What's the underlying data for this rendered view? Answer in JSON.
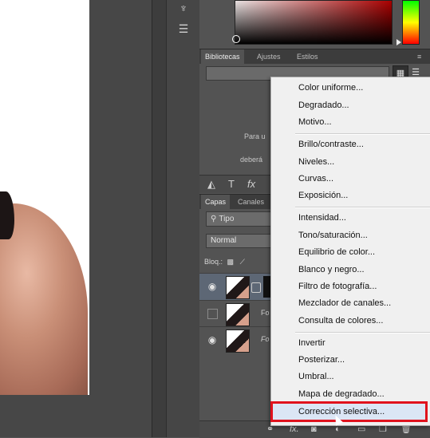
{
  "panels": {
    "library_tabs": [
      "Bibliotecas",
      "Ajustes",
      "Estilos"
    ],
    "library_text": [
      "Para u",
      "deberá"
    ],
    "layers_tabs": [
      "Capas",
      "Canales"
    ],
    "filter_label": "Tipo",
    "blend_mode": "Normal",
    "lock_label": "Bloq.:",
    "layers": [
      {
        "name": "",
        "visible": true
      },
      {
        "name": "Fo",
        "visible": false
      },
      {
        "name": "Fo",
        "visible": true
      }
    ],
    "bottom_fx": "fx."
  },
  "menu": {
    "groups": [
      [
        "Color uniforme...",
        "Degradado...",
        "Motivo..."
      ],
      [
        "Brillo/contraste...",
        "Niveles...",
        "Curvas...",
        "Exposición..."
      ],
      [
        "Intensidad...",
        "Tono/saturación...",
        "Equilibrio de color...",
        "Blanco y negro...",
        "Filtro de fotografía...",
        "Mezclador de canales...",
        "Consulta de colores..."
      ],
      [
        "Invertir",
        "Posterizar...",
        "Umbral...",
        "Mapa de degradado...",
        "Corrección selectiva..."
      ]
    ],
    "highlighted": "Corrección selectiva...",
    "highlight_color": "#e0121d"
  }
}
